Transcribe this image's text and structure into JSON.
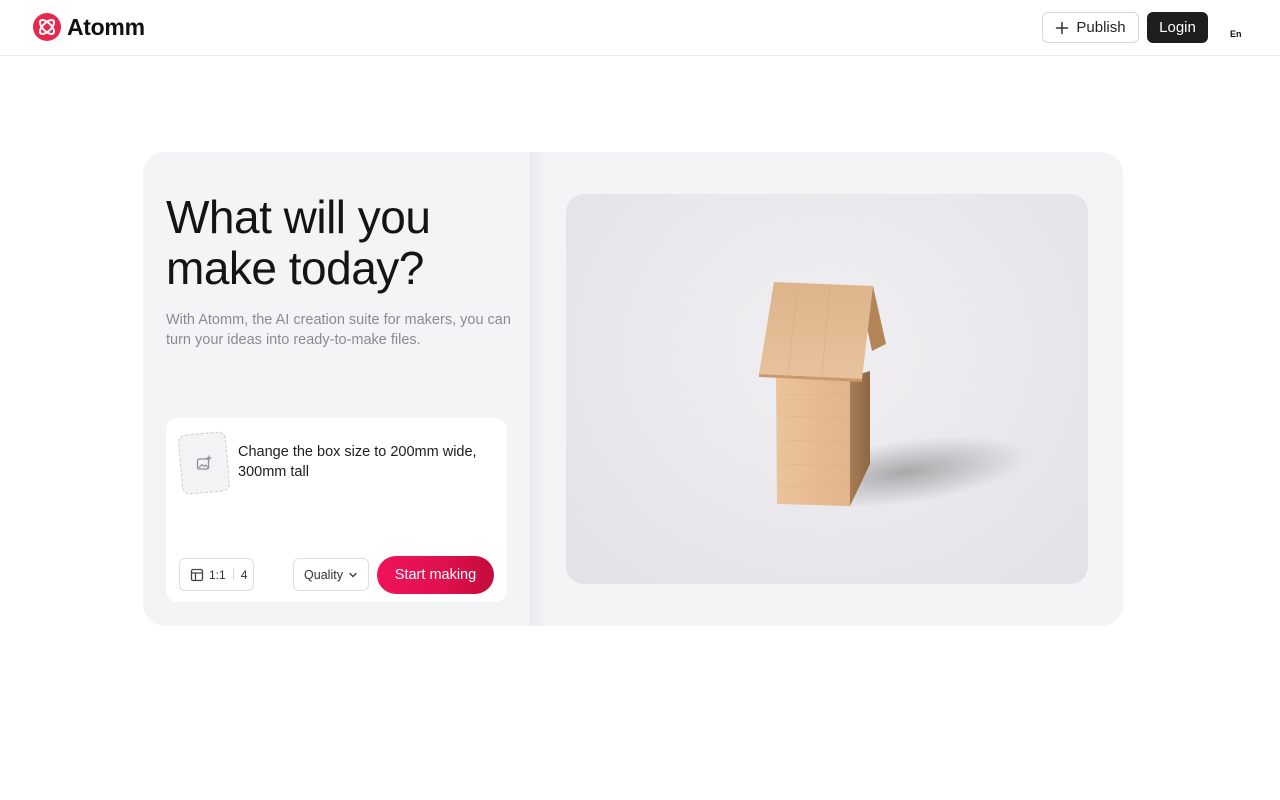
{
  "header": {
    "brand": "Atomm",
    "logo_icon": "atomm-logo-icon",
    "publish_label": "Publish",
    "login_label": "Login",
    "language": "En"
  },
  "hero": {
    "title_line1": "What will you",
    "title_line2": "make today?",
    "subtitle": "With Atomm, the AI creation suite for makers, you can turn your ideas into ready-to-make files."
  },
  "prompt": {
    "text": "Change the box size to 200mm wide, 300mm tall",
    "upload_icon": "image-add-icon",
    "ratio": "1:1",
    "count": "4",
    "quality_label": "Quality",
    "submit_label": "Start making"
  },
  "preview": {
    "subject": "wooden house-shaped box"
  },
  "colors": {
    "accent": "#e8114f",
    "login_bg": "#1e1e1e",
    "card_bg": "#f4f4f7"
  }
}
